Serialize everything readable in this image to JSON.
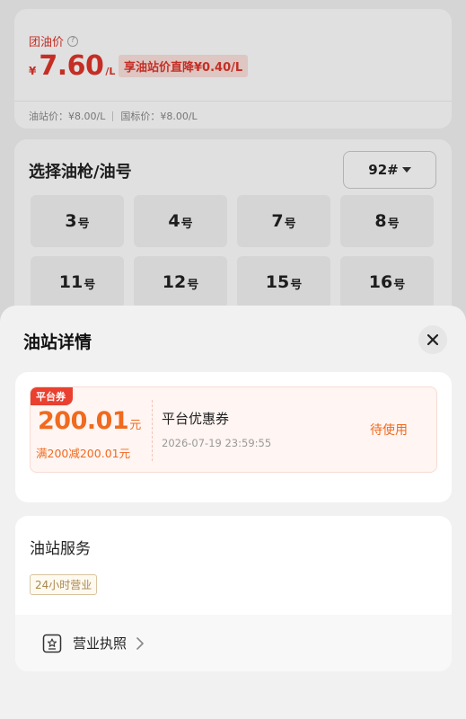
{
  "price_card": {
    "label": "团油价",
    "price_yen": "¥",
    "price": "7.60",
    "price_unit": "/L",
    "discount_text": "享油站价直降¥0.40/L",
    "station_price": "油站价：¥8.00/L",
    "national_price": "国标价：¥8.00/L"
  },
  "nozzle": {
    "title": "选择油枪/油号",
    "fuel_type": "92#",
    "suffix": "号",
    "items": [
      {
        "num": "3"
      },
      {
        "num": "4"
      },
      {
        "num": "7"
      },
      {
        "num": "8"
      },
      {
        "num": "11"
      },
      {
        "num": "12"
      },
      {
        "num": "15"
      },
      {
        "num": "16"
      }
    ]
  },
  "sheet": {
    "title": "油站详情",
    "coupon": {
      "tag": "平台券",
      "amount": "200.01",
      "amount_unit": "元",
      "rule": "满200减200.01元",
      "name": "平台优惠券",
      "expire": "2026-07-19 23:59:55",
      "status": "待使用"
    },
    "services": {
      "title": "油站服务",
      "tag": "24小时营业",
      "license_label": "营业执照"
    }
  },
  "colors": {
    "price_red": "#e0352b",
    "coupon_orange": "#f06a1f",
    "coupon_tag_red": "#e94030"
  },
  "icons": {
    "info": "info-icon",
    "caret": "caret-down-icon",
    "close": "close-icon",
    "license": "license-icon",
    "chevron": "chevron-right-icon"
  }
}
